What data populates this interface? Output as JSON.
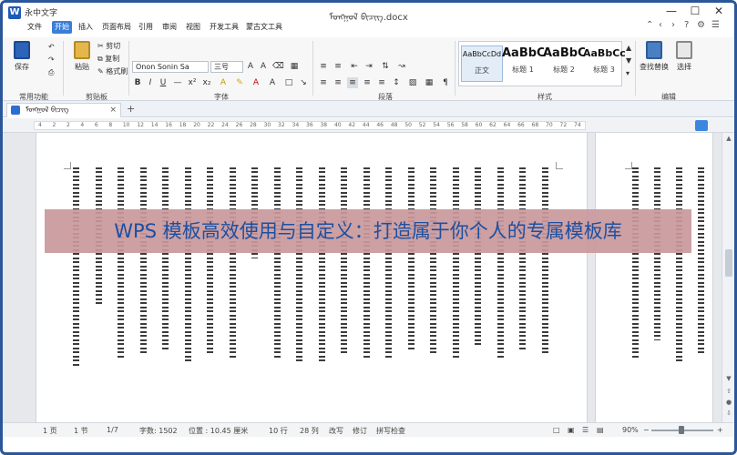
{
  "app": {
    "icon_letter": "W",
    "name": "永中文字",
    "doc_title": "ᠮᠣᠩᠭᠣᠯ ᠪᠢᠴᠢᠭ.docx"
  },
  "window_controls": {
    "minimize": "—",
    "maximize": "☐",
    "close": "✕"
  },
  "menu": [
    "文件",
    "开始",
    "插入",
    "页面布局",
    "引用",
    "审阅",
    "视图",
    "开发工具",
    "蒙古文工具"
  ],
  "ribbon": {
    "groups": {
      "common": "常用功能",
      "clipboard": "剪贴板",
      "font": "字体",
      "paragraph": "段落",
      "styles": "样式",
      "edit": "编辑"
    },
    "save": "保存",
    "paste": "粘贴",
    "cut": "剪切",
    "copy": "复制",
    "format_painter": "格式刷",
    "font_name": "Onon Sonin Sa",
    "font_size": "三号",
    "styles": [
      {
        "sample": "AaBbCcDd",
        "name": "正文"
      },
      {
        "sample": "AaBbC",
        "name": "标题 1"
      },
      {
        "sample": "AaBbC",
        "name": "标题 2"
      },
      {
        "sample": "AaBbCc",
        "name": "标题 3"
      }
    ],
    "find_replace": "查找替换",
    "select": "选择"
  },
  "tab": {
    "label": "ᠮᠣᠩᠭᠣᠯ ᠪᠢᠴᠢᠭ",
    "close": "×",
    "new": "+"
  },
  "ruler": [
    "4",
    "2",
    "2",
    "4",
    "6",
    "8",
    "10",
    "12",
    "14",
    "16",
    "18",
    "20",
    "22",
    "24",
    "26",
    "28",
    "30",
    "32",
    "34",
    "36",
    "38",
    "40",
    "42",
    "44",
    "46",
    "48",
    "50",
    "52",
    "54",
    "56",
    "58",
    "60",
    "62",
    "64",
    "66",
    "68",
    "70",
    "72",
    "74"
  ],
  "banner": "WPS 模板高效使用与自定义：打造属于你个人的专属模板库",
  "status": {
    "page": "1 页",
    "section": "1 节",
    "pages": "1/7",
    "words": "字数: 1502",
    "position": "位置 : 10.45 厘米",
    "line": "10 行",
    "col": "28 列",
    "revise": "改写",
    "track": "修订",
    "spell": "拼写检查",
    "zoom": "90%"
  },
  "colors": {
    "accent": "#3b7ed8",
    "banner_bg": "#c9989c",
    "banner_text": "#1d4fa0",
    "frame": "#2a579a"
  }
}
